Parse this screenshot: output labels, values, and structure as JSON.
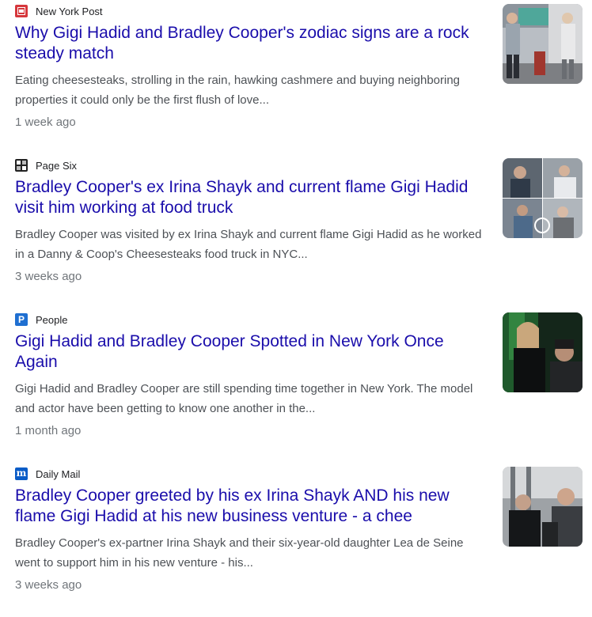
{
  "articles": [
    {
      "source": "New York Post",
      "source_icon": "new-york-post-icon",
      "headline": "Why Gigi Hadid and Bradley Cooper's zodiac signs are a rock steady match",
      "snippet": "Eating cheesesteaks, strolling in the rain, hawking cashmere and buying neighboring properties it could only be the first flush of love...",
      "time": "1 week ago"
    },
    {
      "source": "Page Six",
      "source_icon": "page-six-icon",
      "headline": "Bradley Cooper's ex Irina Shayk and current flame Gigi Hadid visit him working at food truck",
      "snippet": "Bradley Cooper was visited by ex Irina Shayk and current flame Gigi Hadid as he worked in a Danny & Coop's Cheesesteaks food truck in NYC...",
      "time": "3 weeks ago"
    },
    {
      "source": "People",
      "source_icon": "people-icon",
      "icon_letter": "P",
      "headline": "Gigi Hadid and Bradley Cooper Spotted in New York Once Again",
      "snippet": "Gigi Hadid and Bradley Cooper are still spending time together in New York. The model and actor have been getting to know one another in the...",
      "time": "1 month ago"
    },
    {
      "source": "Daily Mail",
      "source_icon": "daily-mail-icon",
      "icon_letter": "m",
      "headline": "Bradley Cooper greeted by his ex Irina Shayk AND his new flame Gigi Hadid at his new business venture - a chee",
      "snippet": "Bradley Cooper's ex-partner Irina Shayk and their six-year-old daughter Lea de Seine went to support him in his new venture - his...",
      "time": "3 weeks ago"
    }
  ]
}
